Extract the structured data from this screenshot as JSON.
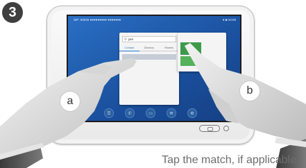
{
  "step": {
    "number": "3"
  },
  "screen": {
    "status_sip": "SIP: 50635 ●●●●●●●●● ●●●●●●●",
    "status_right": "● ◙ 10:00",
    "search": {
      "value": "jam"
    },
    "tabs": [
      {
        "label": "Contacts",
        "active": true
      },
      {
        "label": "Directory",
        "active": false
      },
      {
        "label": "Recents",
        "active": false
      }
    ],
    "dock_icons": [
      "contacts-icon",
      "phone-icon",
      "message-icon",
      "mail-icon",
      "settings-icon"
    ]
  },
  "labels": {
    "left_hand": "a",
    "right_hand": "b"
  },
  "caption": "Tap the match, if applicable",
  "colors": {
    "screen": "#1a4f9c",
    "accent": "#1f78c9",
    "panel_green": "#3e9a4a"
  }
}
